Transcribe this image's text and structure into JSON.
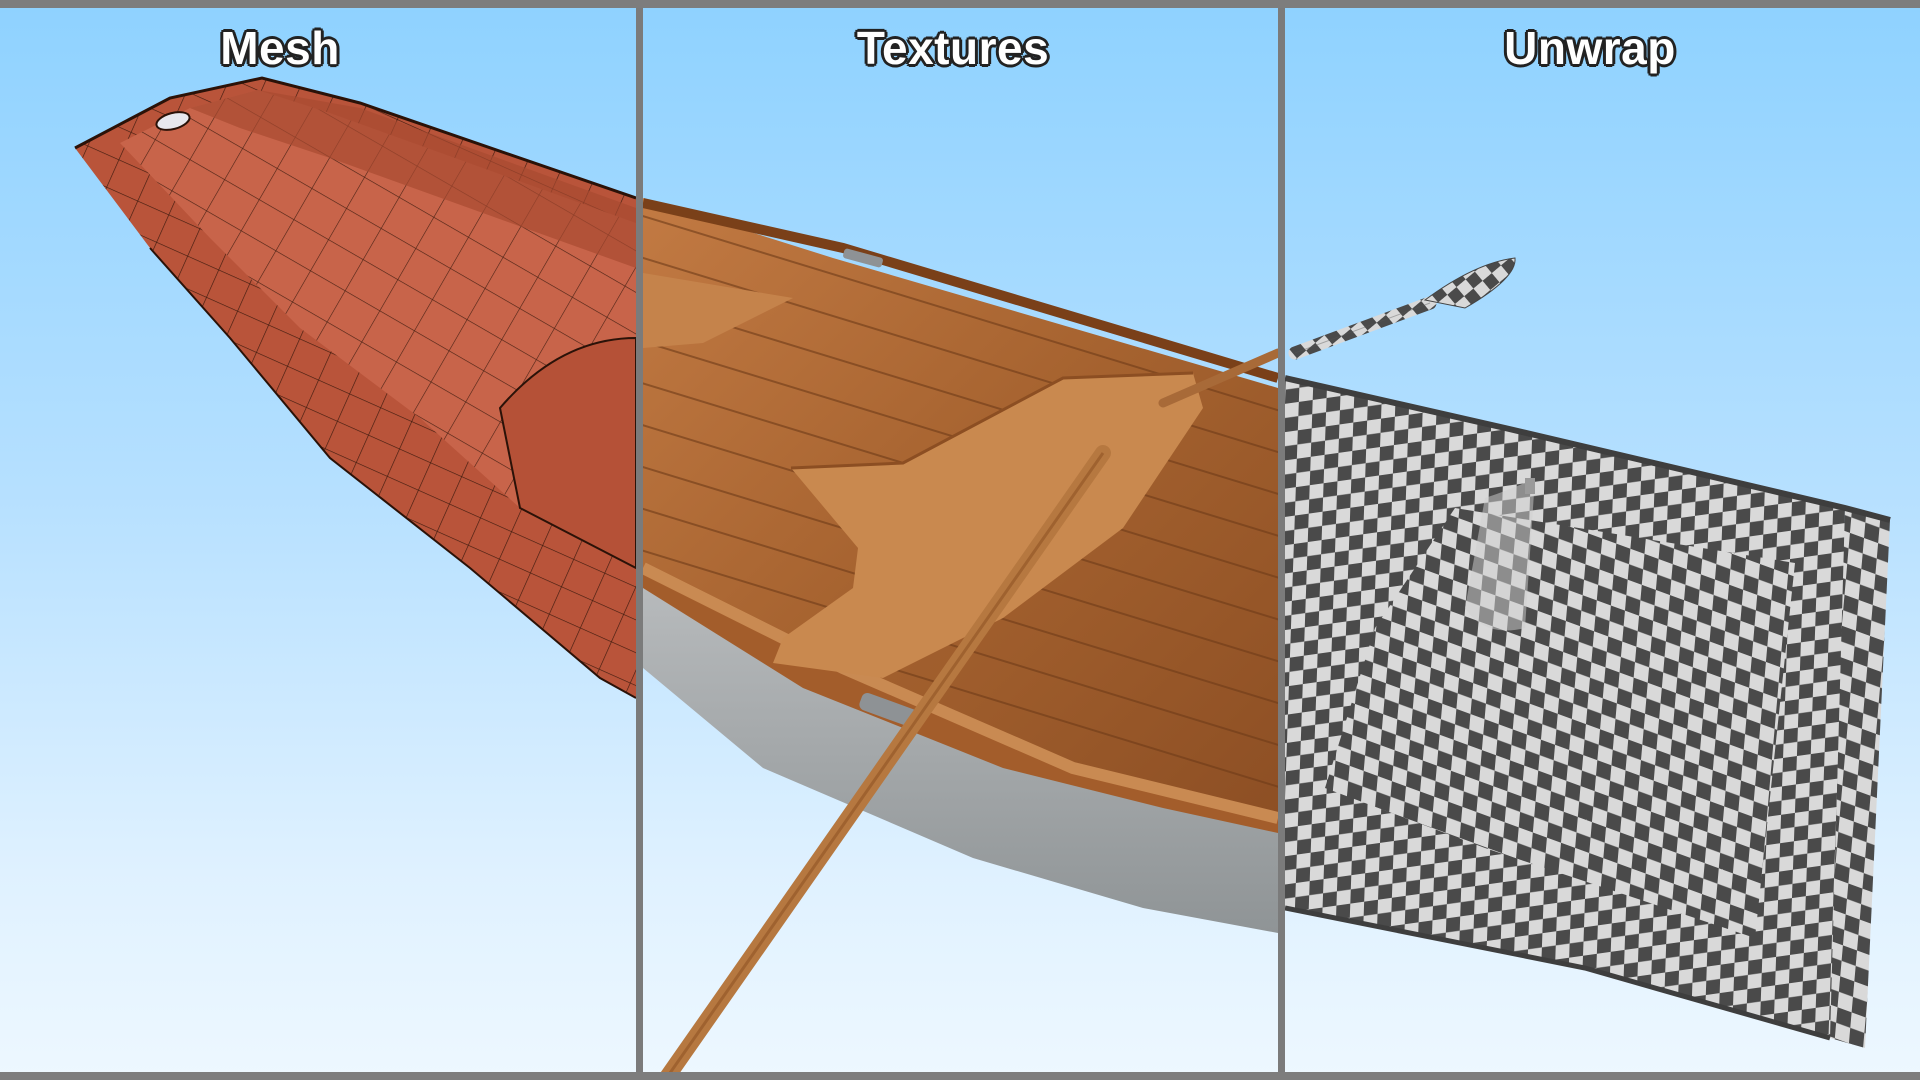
{
  "panels": [
    {
      "id": "mesh",
      "label": "Mesh"
    },
    {
      "id": "textures",
      "label": "Textures"
    },
    {
      "id": "unwrap",
      "label": "Unwrap"
    }
  ],
  "colors": {
    "sky_top": "#8fd2ff",
    "sky_bottom": "#eef8ff",
    "mesh_clay": "#c0573a",
    "wood": "#b06d3a",
    "hull_grey": "#a9adb0",
    "checker_dark": "#4a4a4a",
    "checker_light": "#d9d9d9",
    "divider": "#7b7b7b"
  }
}
